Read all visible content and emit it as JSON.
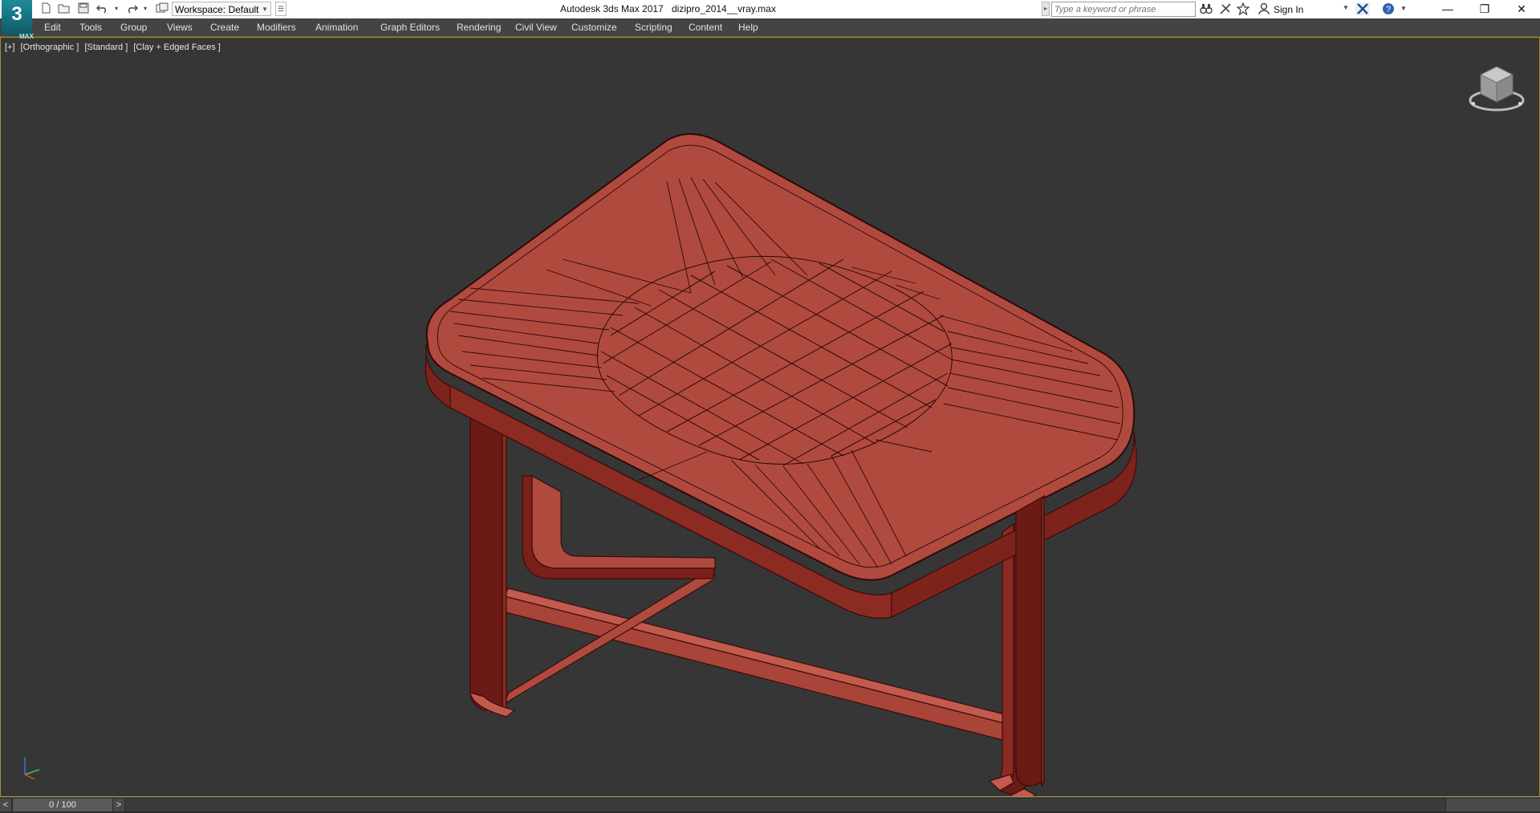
{
  "app": {
    "logo_text": "3",
    "logo_sub": "MAX",
    "title": "Autodesk 3ds Max 2017",
    "file_name": "dizipro_2014__vray.max"
  },
  "workspace": {
    "label": "Workspace: Default"
  },
  "search": {
    "placeholder": "Type a keyword or phrase"
  },
  "account": {
    "sign_in": "Sign In"
  },
  "menu": {
    "items": [
      "Edit",
      "Tools",
      "Group",
      "Views",
      "Create",
      "Modifiers",
      "Animation",
      "Graph Editors",
      "Rendering",
      "Civil View",
      "Customize",
      "Scripting",
      "Content",
      "Help"
    ]
  },
  "viewport": {
    "labels": [
      "[+]",
      "[Orthographic ]",
      "[Standard ]",
      "[Clay + Edged Faces ]"
    ],
    "object_color": "#b04a3f",
    "object_dark": "#6b1a16",
    "background": "#363636"
  },
  "timeline": {
    "frame_display": "0 / 100",
    "prev": "<",
    "next": ">"
  },
  "icons": {
    "new": "new-file-icon",
    "open": "open-file-icon",
    "save": "save-icon",
    "undo": "undo-icon",
    "redo": "redo-icon",
    "project": "project-folder-icon",
    "search": "binoculars-icon",
    "favorites": "star-icon",
    "help": "help-icon",
    "autodesk": "autodesk-x-icon"
  }
}
